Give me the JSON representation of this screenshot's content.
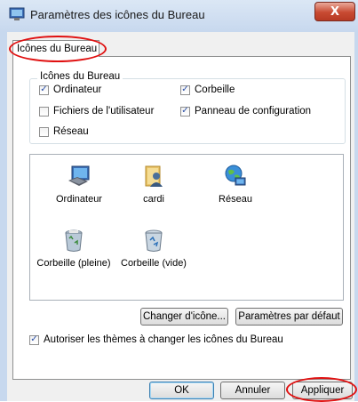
{
  "window": {
    "title": "Paramètres des icônes du Bureau",
    "close_glyph": "X"
  },
  "tabs": [
    {
      "label": "Icônes du Bureau"
    }
  ],
  "group": {
    "label": "Icônes du Bureau",
    "checkboxes": [
      {
        "label": "Ordinateur",
        "checked": true
      },
      {
        "label": "Corbeille",
        "checked": true
      },
      {
        "label": "Fichiers de l'utilisateur",
        "checked": false
      },
      {
        "label": "Panneau de configuration",
        "checked": true
      },
      {
        "label": "Réseau",
        "checked": false
      }
    ]
  },
  "icons": [
    {
      "label": "Ordinateur",
      "icon": "computer-icon"
    },
    {
      "label": "cardi",
      "icon": "user-folder-icon"
    },
    {
      "label": "Réseau",
      "icon": "network-icon"
    },
    {
      "label": "Corbeille (pleine)",
      "icon": "recycle-bin-full-icon"
    },
    {
      "label": "Corbeille (vide)",
      "icon": "recycle-bin-empty-icon"
    }
  ],
  "buttons": {
    "change_icon": "Changer d'icône...",
    "restore_default": "Paramètres par défaut",
    "ok": "OK",
    "cancel": "Annuler",
    "apply": "Appliquer"
  },
  "themes_checkbox": {
    "label": "Autoriser les thèmes à changer les icônes du Bureau",
    "checked": true
  },
  "colors": {
    "annotation": "#e01010",
    "check": "#2a4fa8"
  }
}
